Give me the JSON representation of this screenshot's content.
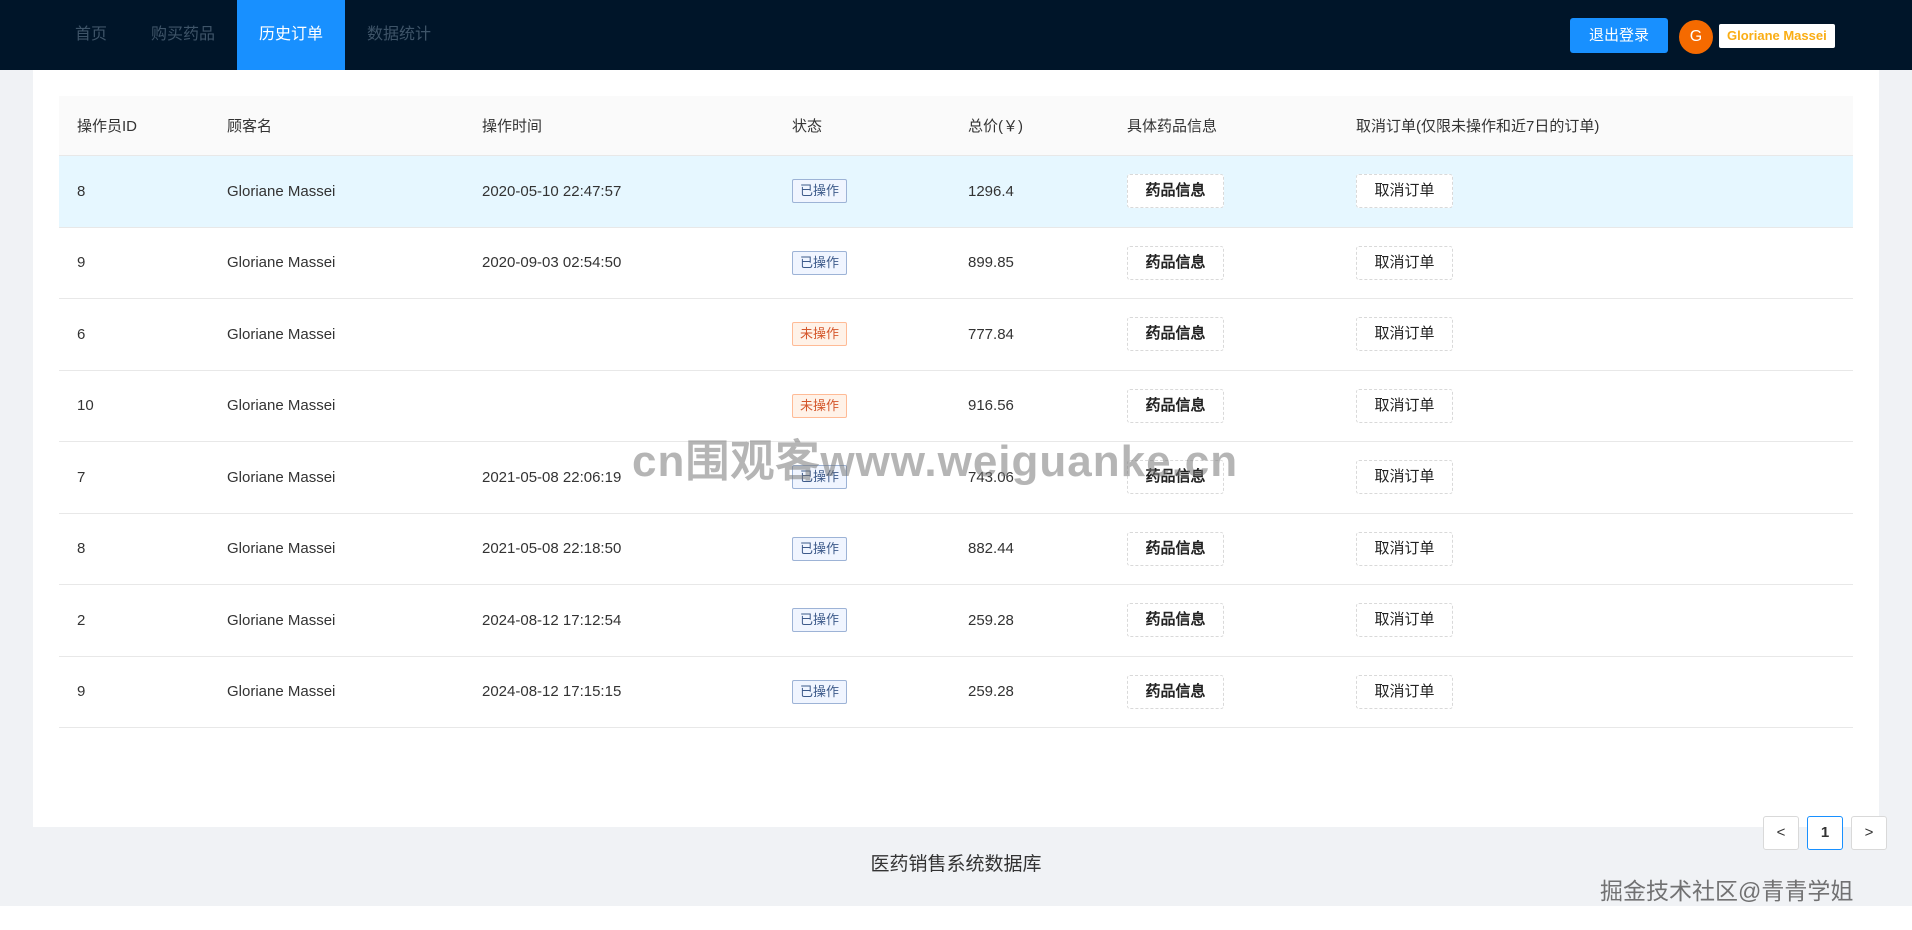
{
  "nav": {
    "items": [
      "首页",
      "购买药品",
      "历史订单",
      "数据统计"
    ],
    "active_index": 2,
    "logout_label": "退出登录",
    "avatar_letter": "G",
    "user_name": "Gloriane Massei"
  },
  "table": {
    "headers": [
      "操作员ID",
      "顾客名",
      "操作时间",
      "状态",
      "总价(￥)",
      "具体药品信息",
      "取消订单(仅限未操作和近7日的订单)"
    ],
    "medicine_btn": "药品信息",
    "cancel_btn": "取消订单",
    "rows": [
      {
        "id": "8",
        "customer": "Gloriane Massei",
        "time": "2020-05-10 22:47:57",
        "status": "已操作",
        "total": "1296.4"
      },
      {
        "id": "9",
        "customer": "Gloriane Massei",
        "time": "2020-09-03 02:54:50",
        "status": "已操作",
        "total": "899.85"
      },
      {
        "id": "6",
        "customer": "Gloriane Massei",
        "time": "",
        "status": "未操作",
        "total": "777.84"
      },
      {
        "id": "10",
        "customer": "Gloriane Massei",
        "time": "",
        "status": "未操作",
        "total": "916.56"
      },
      {
        "id": "7",
        "customer": "Gloriane Massei",
        "time": "2021-05-08 22:06:19",
        "status": "已操作",
        "total": "743.06"
      },
      {
        "id": "8",
        "customer": "Gloriane Massei",
        "time": "2021-05-08 22:18:50",
        "status": "已操作",
        "total": "882.44"
      },
      {
        "id": "2",
        "customer": "Gloriane Massei",
        "time": "2024-08-12 17:12:54",
        "status": "已操作",
        "total": "259.28"
      },
      {
        "id": "9",
        "customer": "Gloriane Massei",
        "time": "2024-08-12 17:15:15",
        "status": "已操作",
        "total": "259.28"
      }
    ]
  },
  "pagination": {
    "prev": "<",
    "current": "1",
    "next": ">"
  },
  "footer": {
    "text": "医药销售系统数据库"
  },
  "watermark": "cn围观客www.weiguanke.cn",
  "corner_watermark": "掘金技术社区@青青学姐"
}
